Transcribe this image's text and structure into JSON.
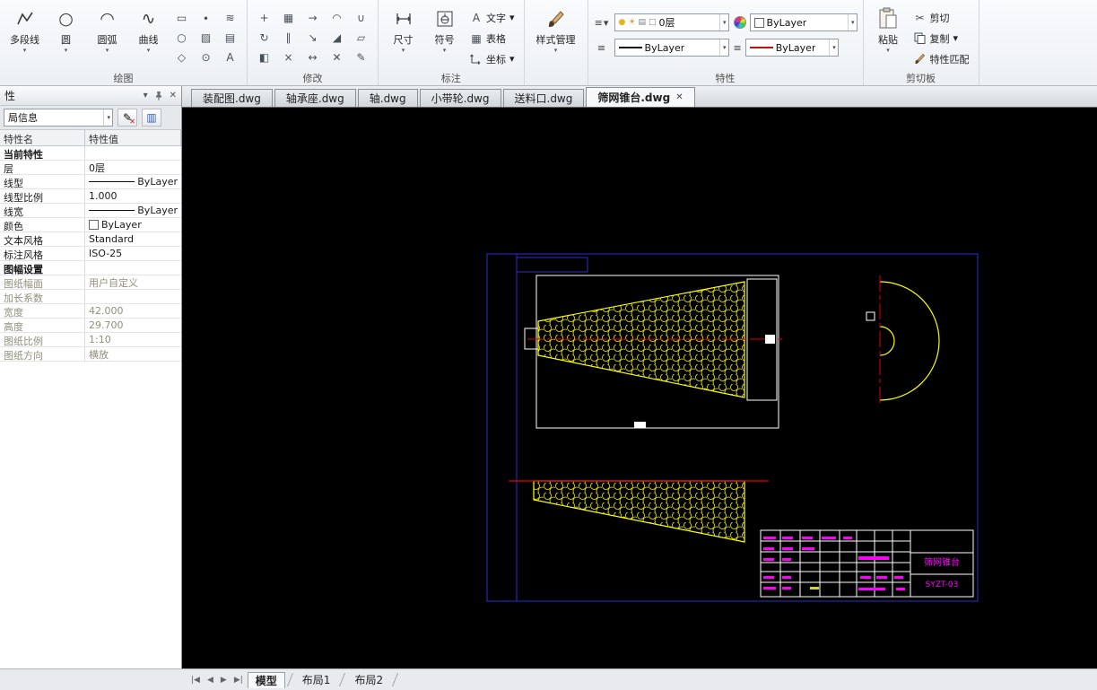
{
  "icons": {
    "chevron": "▾",
    "close": "✕",
    "cut": "✂",
    "menu": "≡",
    "pencil": "✎",
    "blue_panel": "▥",
    "bulb": "●",
    "sun": "☀",
    "printer": "▤",
    "box": "□",
    "circle": "○",
    "arc": "◠",
    "spline": "∿",
    "table": "▦",
    "text_tool": "A"
  },
  "ribbon": {
    "draw": {
      "label": "绘图",
      "buttons": [
        {
          "label": "多段线"
        },
        {
          "label": "圆"
        },
        {
          "label": "圆弧"
        },
        {
          "label": "曲线"
        }
      ],
      "small": [
        "▭",
        "○",
        "◇",
        "∙",
        "▨",
        "⊙",
        "≋",
        "▤",
        "A"
      ]
    },
    "modify": {
      "label": "修改",
      "small": [
        "+",
        "↻",
        "◧",
        "▦",
        "∥",
        "×",
        "→",
        "↘",
        "↔",
        "◠",
        "◢",
        "✕",
        "∪",
        "▱",
        "✎"
      ]
    },
    "annotate": {
      "label": "标注",
      "buttons": [
        {
          "label": "尺寸"
        },
        {
          "label": "符号"
        }
      ],
      "stack": [
        {
          "label": "文字"
        },
        {
          "label": "表格"
        },
        {
          "label": "坐标"
        }
      ]
    },
    "style_manager": {
      "label": "样式管理"
    },
    "props": {
      "label": "特性",
      "layer": "0层",
      "color": "ByLayer",
      "linetype": "ByLayer",
      "lineweight": "ByLayer"
    },
    "clipboard": {
      "label": "剪切板",
      "paste": "粘贴",
      "cut": "剪切",
      "copy": "复制",
      "match": "特性匹配"
    }
  },
  "doc_tabs": [
    {
      "label": "装配图.dwg"
    },
    {
      "label": "轴承座.dwg"
    },
    {
      "label": "轴.dwg"
    },
    {
      "label": "小带轮.dwg"
    },
    {
      "label": "送料口.dwg"
    },
    {
      "label": "筛网锥台.dwg",
      "active": true
    }
  ],
  "panel": {
    "title": "性",
    "layout_combo": "局信息",
    "col_name": "特性名",
    "col_value": "特性值",
    "rows": [
      {
        "name": "当前特性",
        "value": ""
      },
      {
        "name": "层",
        "value": "0层"
      },
      {
        "name": "线型",
        "value": "ByLayer"
      },
      {
        "name": "线型比例",
        "value": "1.000"
      },
      {
        "name": "线宽",
        "value": "ByLayer"
      },
      {
        "name": "颜色",
        "value": "ByLayer"
      },
      {
        "name": "文本风格",
        "value": "Standard"
      },
      {
        "name": "标注风格",
        "value": "ISO-25"
      },
      {
        "name": "图幅设置",
        "value": ""
      },
      {
        "name": "图纸幅面",
        "value": "用户自定义"
      },
      {
        "name": "加长系数",
        "value": ""
      },
      {
        "name": "宽度",
        "value": "42.000"
      },
      {
        "name": "高度",
        "value": "29.700"
      },
      {
        "name": "图纸比例",
        "value": "1:10"
      },
      {
        "name": "图纸方向",
        "value": "横放"
      }
    ]
  },
  "drawing": {
    "title_block": {
      "name": "筛网锥台",
      "number": "SYZT-03"
    },
    "colors": {
      "frame_blue": "#2b2bd5",
      "outline_yellow": "#ffff00",
      "centerline_red": "#e00000",
      "annotation_magenta": "#ff00ff"
    }
  },
  "statusbar": {
    "nav": [
      "|◀",
      "◀",
      "▶",
      "▶|"
    ],
    "tabs": [
      {
        "label": "模型",
        "active": true
      },
      {
        "label": "布局1"
      },
      {
        "label": "布局2"
      }
    ]
  }
}
